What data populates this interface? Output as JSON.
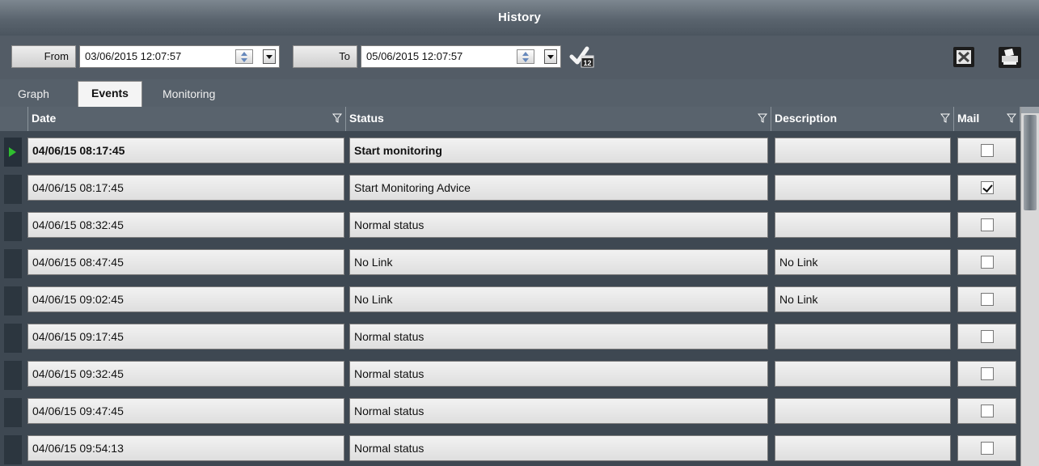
{
  "window": {
    "title": "History"
  },
  "toolbar": {
    "from_label": "From",
    "from_value": "03/06/2015 12:07:57",
    "to_label": "To",
    "to_value": "05/06/2015 12:07:57",
    "calendar_icon": "calendar-check-icon",
    "calendar_day": "12",
    "excel_icon": "excel-icon",
    "print_icon": "printer-icon"
  },
  "tabs": [
    {
      "label": "Graph",
      "active": false
    },
    {
      "label": "Events",
      "active": true
    },
    {
      "label": "Monitoring",
      "active": false
    }
  ],
  "grid": {
    "columns": [
      "Date",
      "Status",
      "Description",
      "Mail"
    ],
    "rows": [
      {
        "date": "04/06/15 08:17:45",
        "status": "Start monitoring",
        "description": "",
        "mail": false,
        "current": true,
        "bold": true
      },
      {
        "date": "04/06/15 08:17:45",
        "status": "Start Monitoring Advice",
        "description": "",
        "mail": true,
        "current": false,
        "bold": false
      },
      {
        "date": "04/06/15 08:32:45",
        "status": "Normal status",
        "description": "",
        "mail": false,
        "current": false,
        "bold": false
      },
      {
        "date": "04/06/15 08:47:45",
        "status": "No Link",
        "description": "No Link",
        "mail": false,
        "current": false,
        "bold": false
      },
      {
        "date": "04/06/15 09:02:45",
        "status": "No Link",
        "description": "No Link",
        "mail": false,
        "current": false,
        "bold": false
      },
      {
        "date": "04/06/15 09:17:45",
        "status": "Normal status",
        "description": "",
        "mail": false,
        "current": false,
        "bold": false
      },
      {
        "date": "04/06/15 09:32:45",
        "status": "Normal status",
        "description": "",
        "mail": false,
        "current": false,
        "bold": false
      },
      {
        "date": "04/06/15 09:47:45",
        "status": "Normal status",
        "description": "",
        "mail": false,
        "current": false,
        "bold": false
      },
      {
        "date": "04/06/15 09:54:13",
        "status": "Normal status",
        "description": "",
        "mail": false,
        "current": false,
        "bold": false
      }
    ]
  },
  "colors": {
    "header_bg": "#59636d",
    "current_row_marker": "#2fbf2f"
  }
}
